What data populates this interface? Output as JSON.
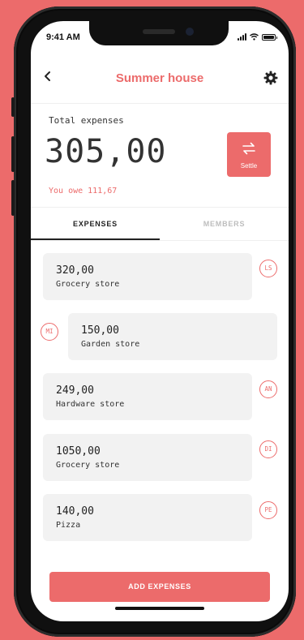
{
  "status_bar": {
    "time": "9:41 AM"
  },
  "header": {
    "title": "Summer house"
  },
  "summary": {
    "total_label": "Total expenses",
    "total_amount": "305,00",
    "owe_text": "You owe 111,67",
    "settle_label": "Settle"
  },
  "tabs": [
    {
      "label": "EXPENSES",
      "active": true
    },
    {
      "label": "MEMBERS",
      "active": false
    }
  ],
  "expenses": [
    {
      "amount": "320,00",
      "name": "Grocery store",
      "member": "LS",
      "side": "right"
    },
    {
      "amount": "150,00",
      "name": "Garden store",
      "member": "MI",
      "side": "left"
    },
    {
      "amount": "249,00",
      "name": "Hardware store",
      "member": "AN",
      "side": "right"
    },
    {
      "amount": "1050,00",
      "name": "Grocery store",
      "member": "DI",
      "side": "right"
    },
    {
      "amount": "140,00",
      "name": "Pizza",
      "member": "PE",
      "side": "right"
    }
  ],
  "footer": {
    "add_label": "ADD EXPENSES"
  },
  "colors": {
    "accent": "#ec6b6b",
    "card": "#f2f2f2",
    "text": "#222222",
    "muted": "#bdbdbd"
  },
  "icons": {
    "back": "back-arrow-icon",
    "settings": "gear-icon",
    "settle": "swap-arrows-icon"
  }
}
